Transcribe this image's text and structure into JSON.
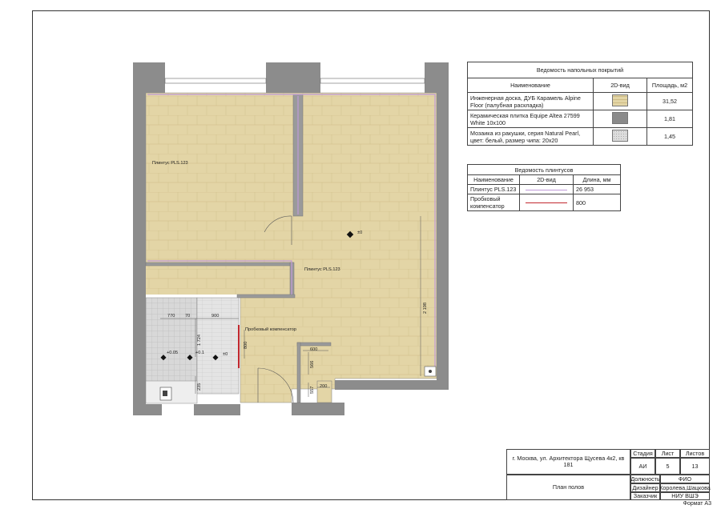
{
  "floor_sheet": {
    "title": "Ведомость напольных покрытий",
    "headers": [
      "Наименование",
      "2D-вид",
      "Площадь, м2"
    ],
    "rows": [
      {
        "name": "Инженерная доска, ДУБ Карамель Alpine Floor (палубная раскладка)",
        "swatch": "oak",
        "area": "31,52"
      },
      {
        "name": "Керамическая плитка Equipe Altea 27599 White 10x100",
        "swatch": "tile",
        "area": "1,81"
      },
      {
        "name": "Мозаика из ракушки, серия Natural Pearl, цвет: белый, размер чипа: 20x20",
        "swatch": "mosaic",
        "area": "1,45"
      }
    ]
  },
  "plinth_sheet": {
    "title": "Ведомость плинтусов",
    "headers": [
      "Наименование",
      "2D-вид",
      "Длина, мм"
    ],
    "rows": [
      {
        "name": "Плинтус PLS.123",
        "line": "lilac",
        "length": "26 953"
      },
      {
        "name": "Пробковый компенсатор",
        "line": "red",
        "length": "800"
      }
    ]
  },
  "plan": {
    "labels": {
      "plinth_1": "Плинтус PLS.123",
      "plinth_2": "Плинтус PLS.123",
      "cork": "Пробковый компенсатор",
      "level_main": "±0",
      "level_bath": "±0",
      "level_01": "+0.1",
      "level_005": "+0.05"
    },
    "dims": {
      "d770": "770",
      "d70": "70",
      "d900": "900",
      "d1724": "1 724",
      "d800": "800",
      "d235": "235",
      "d600": "600",
      "d566": "566",
      "d557": "557",
      "d200": "200",
      "d2198": "2 198"
    },
    "colors": {
      "wall": "#8c8c8c",
      "oak": "#e3d5a6",
      "oak_line": "#cdbb84",
      "tile": "#d6d6d6",
      "plinth": "#c09ad8",
      "cork": "#c2282e"
    }
  },
  "stamp": {
    "address": "г. Москва, ул. Архитектора Щусева 4к2, кв 181",
    "drawing_title": "План полов",
    "stage_label": "Стадия",
    "sheet_label": "Лист",
    "sheets_label": "Листов",
    "stage": "АИ",
    "sheet": "5",
    "sheets": "13",
    "position_label": "Должность",
    "name_label": "ФИО",
    "designer_label": "Дизайнер",
    "designer": "Королева,Шацкова",
    "client_label": "Заказчик",
    "client": "НИУ ВШЭ"
  },
  "format": "Формат А3"
}
